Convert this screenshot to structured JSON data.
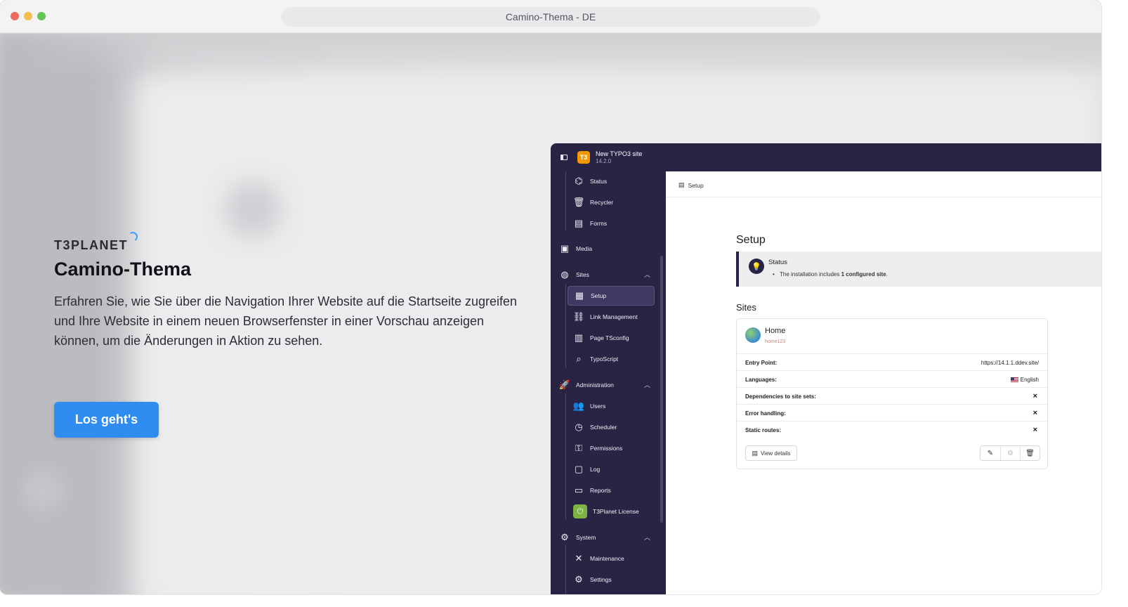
{
  "browser": {
    "title": "Camino-Thema - DE"
  },
  "hero": {
    "logo": "T3PLANET",
    "title": "Camino-Thema",
    "description": "Erfahren Sie, wie Sie über die Navigation Ihrer Website auf die Startseite zugreifen und Ihre Website in einem neuen Browserfenster in einer Vorschau anzeigen können, um die Änderungen in Aktion zu sehen.",
    "cta_label": "Los geht's"
  },
  "backend": {
    "site_name": "New TYPO3 site",
    "version": "14.2.0",
    "logo_text": "T3",
    "sidebar": {
      "status": "Status",
      "recycler": "Recycler",
      "forms": "Forms",
      "media": "Media",
      "sites": "Sites",
      "setup": "Setup",
      "link_management": "Link Management",
      "page_tsconfig": "Page TSconfig",
      "typoscript": "TypoScript",
      "administration": "Administration",
      "users": "Users",
      "scheduler": "Scheduler",
      "permissions": "Permissions",
      "log": "Log",
      "reports": "Reports",
      "t3planet_license": "T3Planet License",
      "system": "System",
      "maintenance": "Maintenance",
      "settings": "Settings"
    },
    "content": {
      "breadcrumb": "Setup",
      "title": "Setup",
      "status_heading": "Status",
      "status_text_prefix": "The installation includes",
      "status_text_bold": "1 configured site",
      "status_text_suffix": ".",
      "sites_heading": "Sites",
      "site_card": {
        "name": "Home",
        "identifier": "home123",
        "entry_point_label": "Entry Point:",
        "entry_point_value": "https://14.1.1.ddev.site/",
        "languages_label": "Languages:",
        "languages_value": "English",
        "dependencies_label": "Dependencies to site sets:",
        "error_handling_label": "Error handling:",
        "static_routes_label": "Static routes:",
        "cross": "×",
        "view_details": "View details"
      }
    }
  }
}
